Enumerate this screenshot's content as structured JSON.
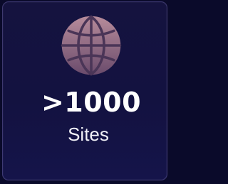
{
  "stat": {
    "value": ">1000",
    "label": "Sites",
    "icon": "globe-icon"
  },
  "colors": {
    "background": "#0a0a2a",
    "card": "#15133f",
    "icon_light": "#b58a9a",
    "icon_dark": "#5e4463",
    "text": "#ffffff"
  }
}
